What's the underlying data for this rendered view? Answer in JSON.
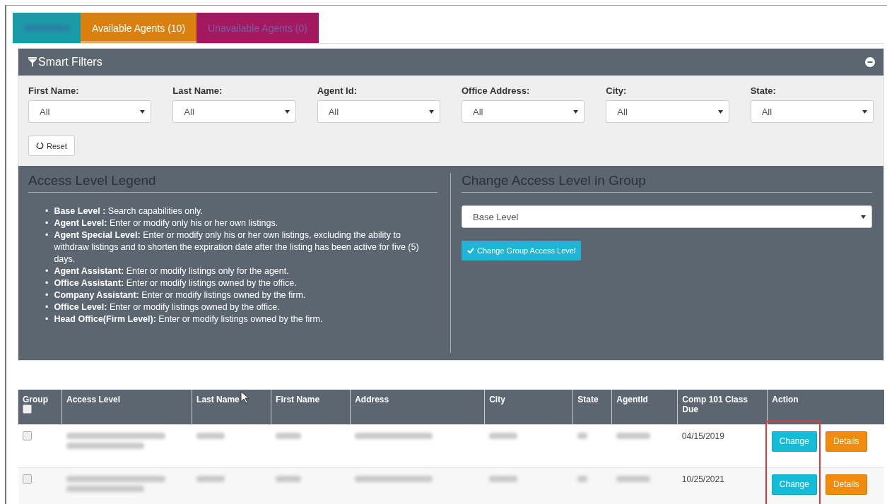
{
  "tabs": [
    {
      "kind": "redacted",
      "selected": false
    },
    {
      "kind": "text",
      "label": "Available Agents (10)",
      "selected": true
    },
    {
      "kind": "text",
      "label": "Unavailable Agents (0)",
      "selected": false
    }
  ],
  "smart_filters": {
    "title": "Smart Filters",
    "expanded": true,
    "filters": [
      {
        "label": "First Name:",
        "value": "All"
      },
      {
        "label": "Last Name:",
        "value": "All"
      },
      {
        "label": "Agent Id:",
        "value": "All"
      },
      {
        "label": "Office Address:",
        "value": "All"
      },
      {
        "label": "City:",
        "value": "All"
      },
      {
        "label": "State:",
        "value": "All"
      }
    ],
    "reset_button": "Reset"
  },
  "legend": {
    "title": "Access Level Legend",
    "bullet": "•",
    "items": [
      {
        "text": "**Base Level :** Search capabilities only."
      },
      {
        "text": "**Agent Level:** Enter or modify only his or her own listings."
      },
      {
        "text": "**Agent Special Level:** Enter or modify only his or her own listings, excluding the ability to withdraw listings and to shorten the expiration date after the listing has been active for five (5) days."
      },
      {
        "text": "**Agent Assistant:** Enter or modify listings only for the agent."
      },
      {
        "text": "**Office Assistant:** Enter or modify listings owned by the office."
      },
      {
        "text": "**Company Assistant:** Enter or modify listings owned by the firm."
      },
      {
        "text": "**Office Level:** Enter or modify listings owned by the office."
      },
      {
        "text": "**Head Office(Firm Level):** Enter or modify listings owned by the firm."
      }
    ]
  },
  "group_change": {
    "title": "Change Access Level in Group",
    "select_value": "Base Level",
    "button": "Change Group Access Level"
  },
  "table": {
    "columns": [
      "Group",
      "Access Level",
      "Last Name",
      "First Name",
      "Address",
      "City",
      "State",
      "AgentId",
      "Comp 101 Class Due",
      "Action"
    ],
    "header_checkbox": {
      "checked": false
    },
    "rows": [
      {
        "checked": false,
        "class_due": "04/15/2019",
        "change_button": "Change",
        "details_button": "Details"
      },
      {
        "checked": false,
        "class_due": "10/25/2021",
        "change_button": "Change",
        "details_button": "Details"
      }
    ]
  }
}
